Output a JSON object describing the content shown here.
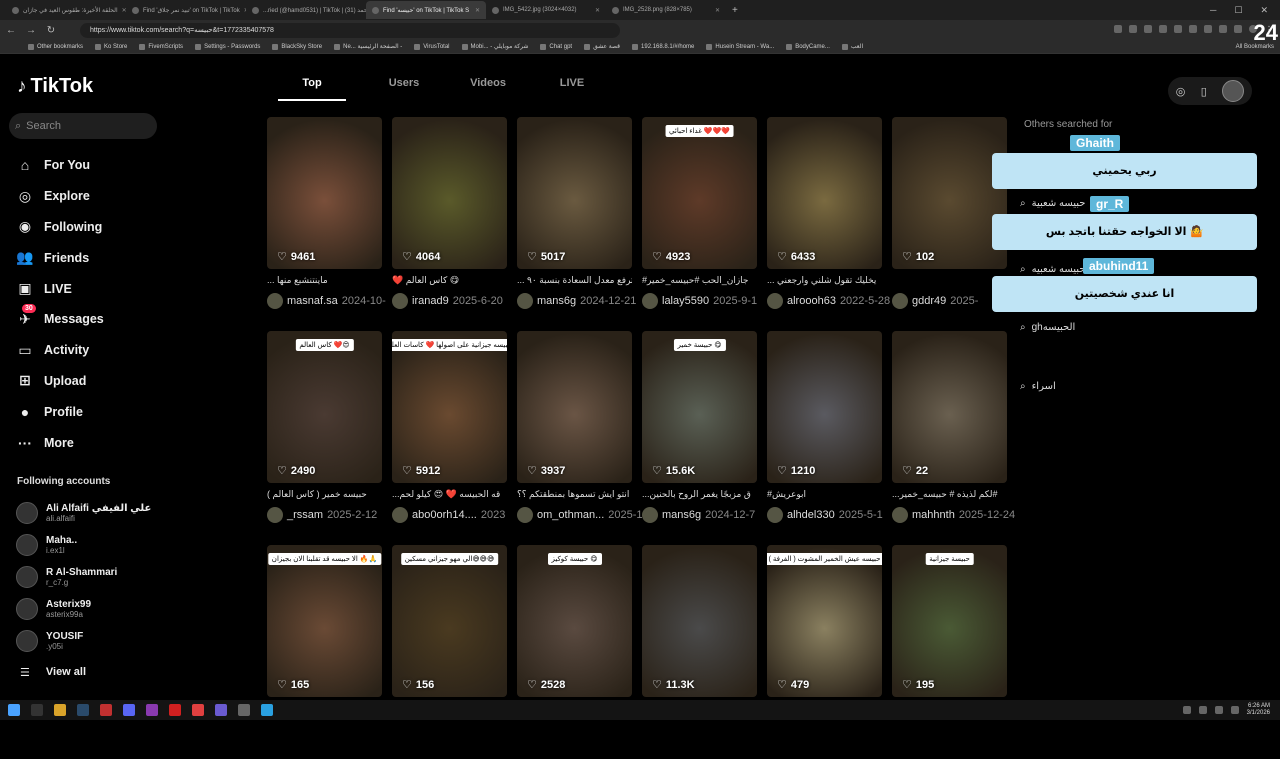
{
  "browser": {
    "tabs": [
      {
        "title": "الحلقة الأخيرة: طقوس العيد في جازان"
      },
      {
        "title": "Find 'تبيد نمر جلاق' on TikTok | TikTok"
      },
      {
        "title": "...ried (@hamd0531) | TikTok | أحمد (31)"
      },
      {
        "title": "Find 'حبيسه' on TikTok | TikTok S",
        "active": true
      },
      {
        "title": "IMG_5422.jpg (3024×4032)"
      },
      {
        "title": "IMG_2528.png (828×785)"
      }
    ],
    "url": "https://www.tiktok.com/search?q=حبيسه&t=1772335407578",
    "bookmarks": [
      "Other bookmarks",
      "Ko Store",
      "FivemScripts",
      "Settings - Passwords",
      "BlackSky Store",
      "Ne... الصفحة الرئيسية -",
      "VirusTotal",
      "Mobi... - شركة موبايلي",
      "Chat gpt",
      "قصة عشق",
      "192.168.8.1/#/home",
      "Husein Stream - Wa...",
      "BodyCame...",
      "العب"
    ],
    "all_bookmarks": "All Bookmarks"
  },
  "sidebar": {
    "logo": "TikTok",
    "search_placeholder": "Search",
    "nav": [
      {
        "label": "For You",
        "icon": "home-icon"
      },
      {
        "label": "Explore",
        "icon": "compass-icon"
      },
      {
        "label": "Following",
        "icon": "following-avatar-icon"
      },
      {
        "label": "Friends",
        "icon": "friends-icon"
      },
      {
        "label": "LIVE",
        "icon": "live-icon"
      },
      {
        "label": "Messages",
        "icon": "messages-icon",
        "badge": "30"
      },
      {
        "label": "Activity",
        "icon": "activity-icon"
      },
      {
        "label": "Upload",
        "icon": "upload-icon"
      },
      {
        "label": "Profile",
        "icon": "profile-avatar-icon"
      },
      {
        "label": "More",
        "icon": "more-icon"
      }
    ],
    "following_title": "Following accounts",
    "following": [
      {
        "name": "Ali Alfaifi علي الفيفي",
        "handle": "ali.alfaifi"
      },
      {
        "name": "Maha..",
        "handle": "i.ex1l"
      },
      {
        "name": "R Al-Shammari",
        "handle": "r_c7.g"
      },
      {
        "name": "Asterix99",
        "handle": "asterix99a"
      },
      {
        "name": "YOUSIF",
        "handle": ".y05i"
      }
    ],
    "view_all": "View all"
  },
  "search_tabs": [
    "Top",
    "Users",
    "Videos",
    "LIVE"
  ],
  "videos": [
    {
      "likes": "9461",
      "caption": "... ماينتنشبع منها",
      "author": "masnaf.sa",
      "date": "2024-10-",
      "color": "#7a4f3a",
      "overlay": ""
    },
    {
      "likes": "4064",
      "caption": "❤️ كاس العالم 😋",
      "author": "iranad9",
      "date": "2025-6-20",
      "color": "#5a5a2a",
      "overlay": ""
    },
    {
      "likes": "5017",
      "caption": "... ترفع معدل السعادة بنسبة ٩٠",
      "author": "mans6g",
      "date": "2024-12-21",
      "color": "#6a5a40",
      "overlay": ""
    },
    {
      "likes": "4923",
      "caption": "#جازان_الحب #حبيسه_خمير",
      "author": "lalay5590",
      "date": "2025-9-1",
      "color": "#5e3a28",
      "overlay": "غداء احبائي ❤️❤️❤️"
    },
    {
      "likes": "6433",
      "caption": "... يخليك تقول شلني وارجعني",
      "author": "alroooh63",
      "date": "2022-5-28",
      "color": "#7a6a40",
      "overlay": ""
    },
    {
      "likes": "102",
      "caption": "",
      "author": "gddr49",
      "date": "2025-",
      "color": "#5a4a30",
      "overlay": ""
    },
    {
      "likes": "2490",
      "caption": "( حبيسه خمير ( كاس العالم",
      "author": "_rssam",
      "date": "2025-2-12",
      "color": "#4a3a32",
      "overlay": "كاس العالم ❤️😍"
    },
    {
      "likes": "5912",
      "caption": "...قه الحبيسه ❤️ 😍 كيلو لحم",
      "author": "abo0orh14....",
      "date": "2023",
      "color": "#6a4a30",
      "overlay": "حبيسه جيزانية على اصولها ❤️ كاسات العلم"
    },
    {
      "likes": "3937",
      "caption": "انتو ايش تسموها بمنطقتكم ؟؟",
      "author": "om_othman...",
      "date": "2025-1",
      "color": "#6a5545",
      "overlay": ""
    },
    {
      "likes": "15.6K",
      "caption": "...ق مزبجًا يغمر الروح بالحنين",
      "author": "mans6g",
      "date": "2024-12-7",
      "color": "#5a6055",
      "overlay": "حبيسة خمير 😋"
    },
    {
      "likes": "1210",
      "caption": "#ابوعريش",
      "author": "alhdel330",
      "date": "2025-5-1",
      "color": "#5a5a60",
      "overlay": ""
    },
    {
      "likes": "22",
      "caption": "...لكم لذيذه # حبيسه_خمير#",
      "author": "mahhnth",
      "date": "2025-12-24",
      "color": "#6a6050",
      "overlay": ""
    },
    {
      "likes": "165",
      "caption": "",
      "author": "",
      "date": "",
      "color": "#6a4a35",
      "overlay": "الا حبيسه قد تقلبنا الان بجيزان 🔥🙏"
    },
    {
      "likes": "156",
      "caption": "",
      "author": "",
      "date": "",
      "color": "#4a3a20",
      "overlay": "الي مهو جيزاني مسكين😅😅😅"
    },
    {
      "likes": "2528",
      "caption": "",
      "author": "",
      "date": "",
      "color": "#5a4a40",
      "overlay": "حبيسة كوكيز 😋"
    },
    {
      "likes": "11.3K",
      "caption": "",
      "author": "",
      "date": "",
      "color": "#4a4a4a",
      "overlay": ""
    },
    {
      "likes": "479",
      "caption": "",
      "author": "",
      "date": "",
      "color": "#8a8060",
      "overlay": "حبيسه عيش الخمير المشوت ( الفرفة )"
    },
    {
      "likes": "195",
      "caption": "",
      "author": "",
      "date": "",
      "color": "#4a5a35",
      "overlay": "حبيسة جيزانية"
    }
  ],
  "others_searched": {
    "title": "Others searched for",
    "items": [
      "حبيسه شعبية",
      "حبيسه شعبيه",
      "ghالحبيسه",
      "اسراء"
    ]
  },
  "chat": [
    {
      "user": "Ghaith",
      "message": "ربي يحميني"
    },
    {
      "user": "gr_R",
      "message": "الا الخواجه حقتنا باتجد بس 🤷"
    },
    {
      "user": "abuhind11",
      "message": "انا عندي شخصيتين"
    }
  ],
  "stream_counter": "24",
  "clock": {
    "time": "6:26 AM",
    "date": "3/1/2026"
  }
}
